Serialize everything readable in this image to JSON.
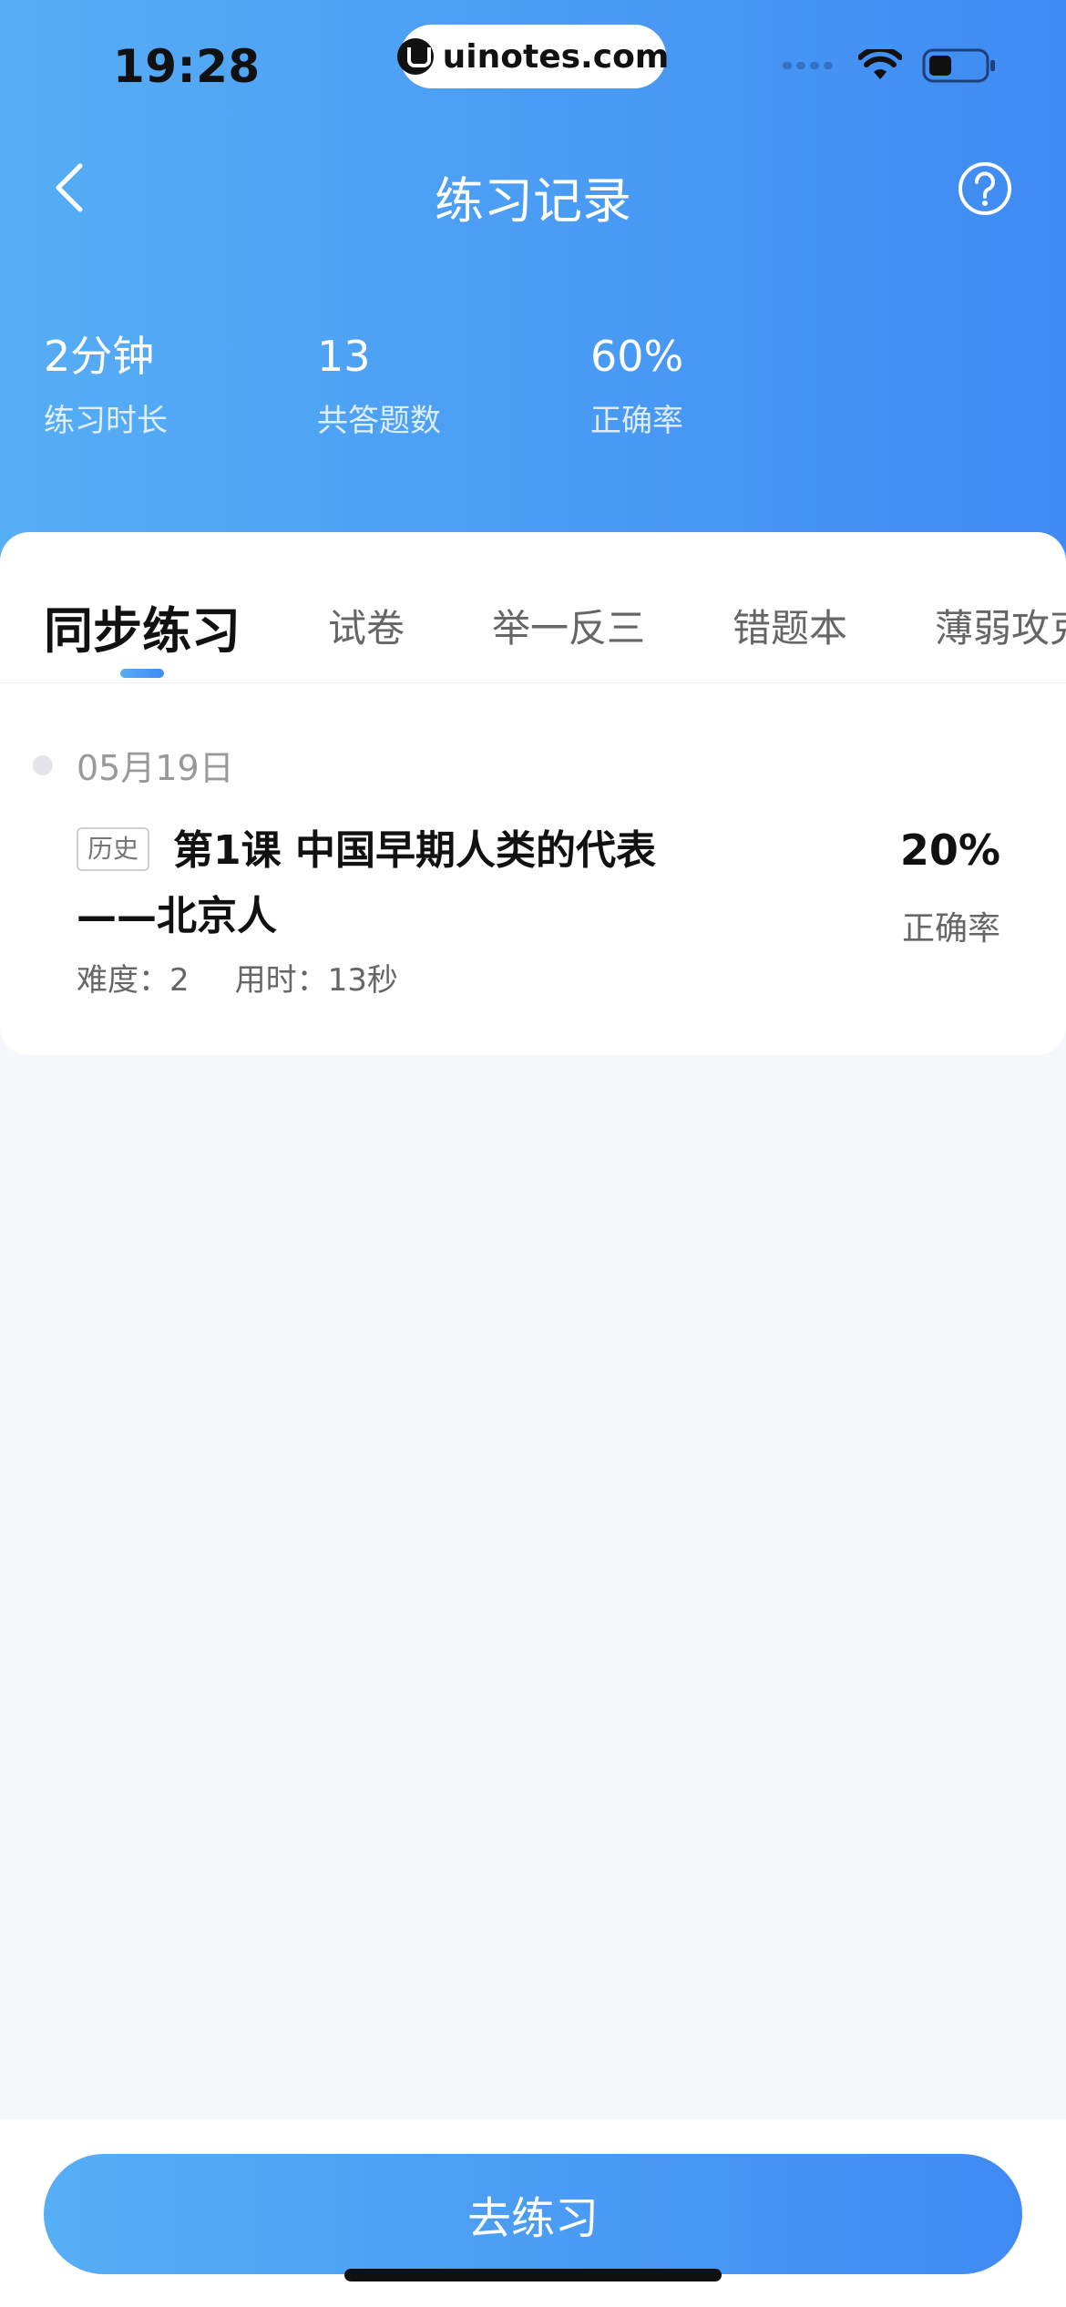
{
  "status_bar": {
    "time": "19:28",
    "url": "uinotes.com"
  },
  "nav": {
    "title": "练习记录"
  },
  "stats": [
    {
      "value": "2分钟",
      "label": "练习时长"
    },
    {
      "value": "13",
      "label": "共答题数"
    },
    {
      "value": "60%",
      "label": "正确率"
    }
  ],
  "tabs": [
    {
      "label": "同步练习",
      "active": true
    },
    {
      "label": "试卷",
      "active": false
    },
    {
      "label": "举一反三",
      "active": false
    },
    {
      "label": "错题本",
      "active": false
    },
    {
      "label": "薄弱攻克",
      "active": false
    }
  ],
  "records": [
    {
      "date": "05月19日",
      "subject": "历史",
      "title_line1": "第1课 中国早期人类的代表",
      "title_line2": "——北京人",
      "difficulty": "难度：2",
      "time_spent": "用时：13秒",
      "rate_value": "20%",
      "rate_label": "正确率"
    }
  ],
  "cta": {
    "label": "去练习"
  },
  "colors": {
    "gradient_start": "#56AEF5",
    "gradient_end": "#3F8BF3",
    "background": "#F5F7FA"
  }
}
